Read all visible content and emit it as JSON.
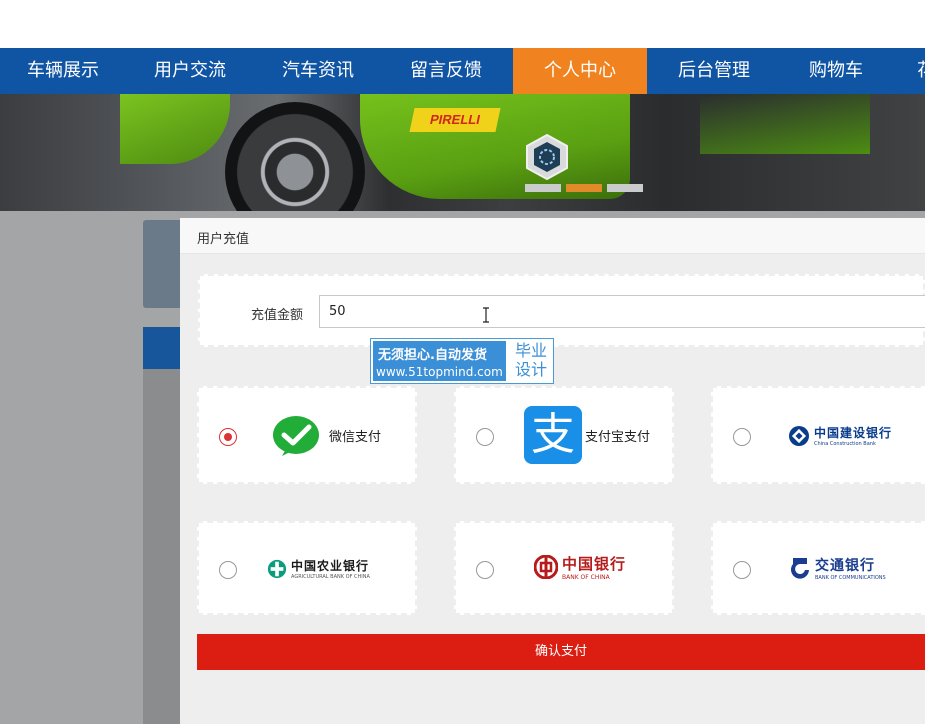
{
  "nav": {
    "items": [
      {
        "label": "车辆展示"
      },
      {
        "label": "用户交流"
      },
      {
        "label": "汽车资讯"
      },
      {
        "label": "留言反馈"
      },
      {
        "label": "个人中心"
      },
      {
        "label": "后台管理"
      },
      {
        "label": "购物车"
      },
      {
        "label": "花"
      }
    ],
    "active_index": 4,
    "active_color": "#f08220",
    "bar_color": "#1055a4"
  },
  "banner": {
    "sponsor_text": "PIRELLI",
    "slide_count": 3,
    "active_slide": 2
  },
  "modal": {
    "title": "用户充值",
    "amount_label": "充值金额",
    "amount_value": "50",
    "confirm_label": "确认支付",
    "confirm_color": "#dc1e12"
  },
  "watermark": {
    "line1": "无须担心.自动发货",
    "line2": "www.51topmind.com",
    "right_line1": "毕业",
    "right_line2": "设计"
  },
  "payment_methods": [
    {
      "id": "wechat",
      "label": "微信支付",
      "selected": true,
      "icon": "wechat-pay-icon"
    },
    {
      "id": "alipay",
      "label": "支付宝支付",
      "selected": false,
      "icon": "alipay-icon",
      "glyph": "支"
    },
    {
      "id": "ccb",
      "name_cn": "中国建设银行",
      "name_en": "China Construction Bank",
      "selected": false,
      "icon": "ccb-logo-icon"
    },
    {
      "id": "abc",
      "name_cn": "中国农业银行",
      "name_en": "AGRICULTURAL BANK OF CHINA",
      "selected": false,
      "icon": "abc-logo-icon"
    },
    {
      "id": "boc",
      "name_cn": "中国银行",
      "name_en": "BANK OF CHINA",
      "selected": false,
      "icon": "boc-logo-icon"
    },
    {
      "id": "bocom",
      "name_cn": "交通银行",
      "name_en": "BANK OF COMMUNICATIONS",
      "selected": false,
      "icon": "bocom-logo-icon"
    }
  ]
}
